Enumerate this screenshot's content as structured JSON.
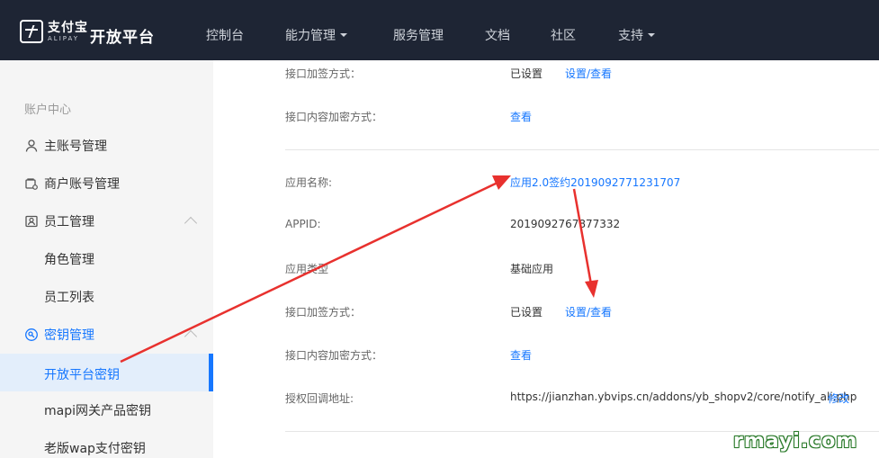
{
  "header": {
    "logo_cn": "支付宝",
    "logo_en": "ALIPAY",
    "platform_title": "开放平台",
    "nav": [
      {
        "label": "控制台",
        "dropdown": false
      },
      {
        "label": "能力管理",
        "dropdown": true
      },
      {
        "label": "服务管理",
        "dropdown": false
      },
      {
        "label": "文档",
        "dropdown": false
      },
      {
        "label": "社区",
        "dropdown": false
      },
      {
        "label": "支持",
        "dropdown": true
      }
    ]
  },
  "sidebar": {
    "section_title": "账户中心",
    "main_account": "主账号管理",
    "merchant_account": "商户账号管理",
    "staff_mgmt": "员工管理",
    "role_mgmt": "角色管理",
    "staff_list": "员工列表",
    "key_mgmt": "密钥管理",
    "open_platform_key": "开放平台密钥",
    "mapi_key": "mapi网关产品密钥",
    "legacy_wap_key": "老版wap支付密钥"
  },
  "content": {
    "top": {
      "sign_label": "接口加签方式：",
      "sign_value": "已设置",
      "sign_link": "设置/查看",
      "encrypt_label": "接口内容加密方式：",
      "encrypt_link": "查看"
    },
    "app": {
      "name_label": "应用名称:",
      "name_value": "应用2.0签约2019092771231707",
      "appid_label": "APPID:",
      "appid_value": "2019092767877332",
      "type_label": "应用类型",
      "type_value": "基础应用",
      "sign_label": "接口加签方式：",
      "sign_value": "已设置",
      "sign_link": "设置/查看",
      "encrypt_label": "接口内容加密方式：",
      "encrypt_link": "查看",
      "callback_label": "授权回调地址:",
      "callback_value": "https://jianzhan.ybvips.cn/addons/yb_shopv2/core/notify_ali.php",
      "callback_link": "修改"
    }
  },
  "watermark": "rmayi.com",
  "colors": {
    "topbar": "#1e2534",
    "sidebar": "#f5f5f5",
    "accent": "#1677ff",
    "annotation_arrow": "#e8312e"
  }
}
